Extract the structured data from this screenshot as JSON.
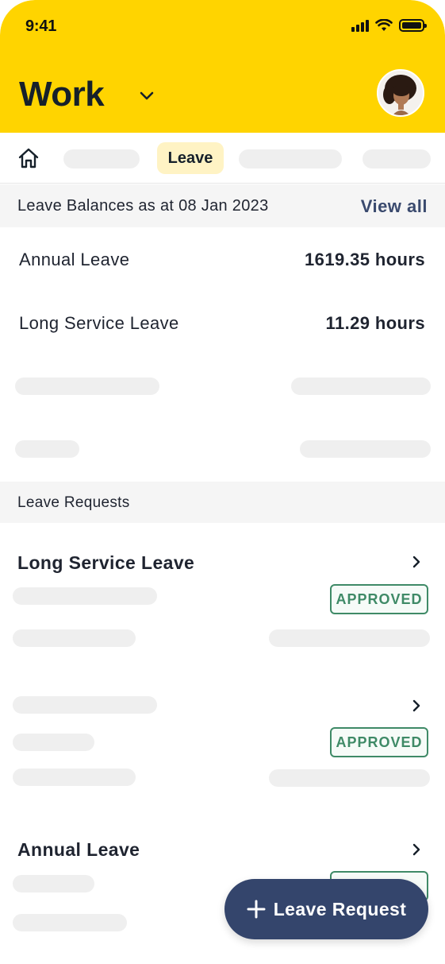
{
  "status_bar": {
    "time": "9:41"
  },
  "header": {
    "title": "Work",
    "brand_color": "#FFD400"
  },
  "tabs": {
    "active_label": "Leave"
  },
  "balances": {
    "heading": "Leave Balances as at 08 Jan 2023",
    "view_all_label": "View all",
    "items": [
      {
        "name": "Annual Leave",
        "value": "1619.35 hours"
      },
      {
        "name": "Long Service Leave",
        "value": "11.29 hours"
      }
    ]
  },
  "requests": {
    "heading": "Leave Requests",
    "items": [
      {
        "title": "Long Service Leave",
        "status": "APPROVED"
      },
      {
        "title": "",
        "status": "APPROVED"
      },
      {
        "title": "Annual Leave",
        "status": ""
      }
    ]
  },
  "fab": {
    "label": "Leave Request",
    "color": "#34456C"
  },
  "colors": {
    "approved": "#3F8A67",
    "link": "#3A4A6E",
    "skeleton": "#EFEFEF"
  }
}
